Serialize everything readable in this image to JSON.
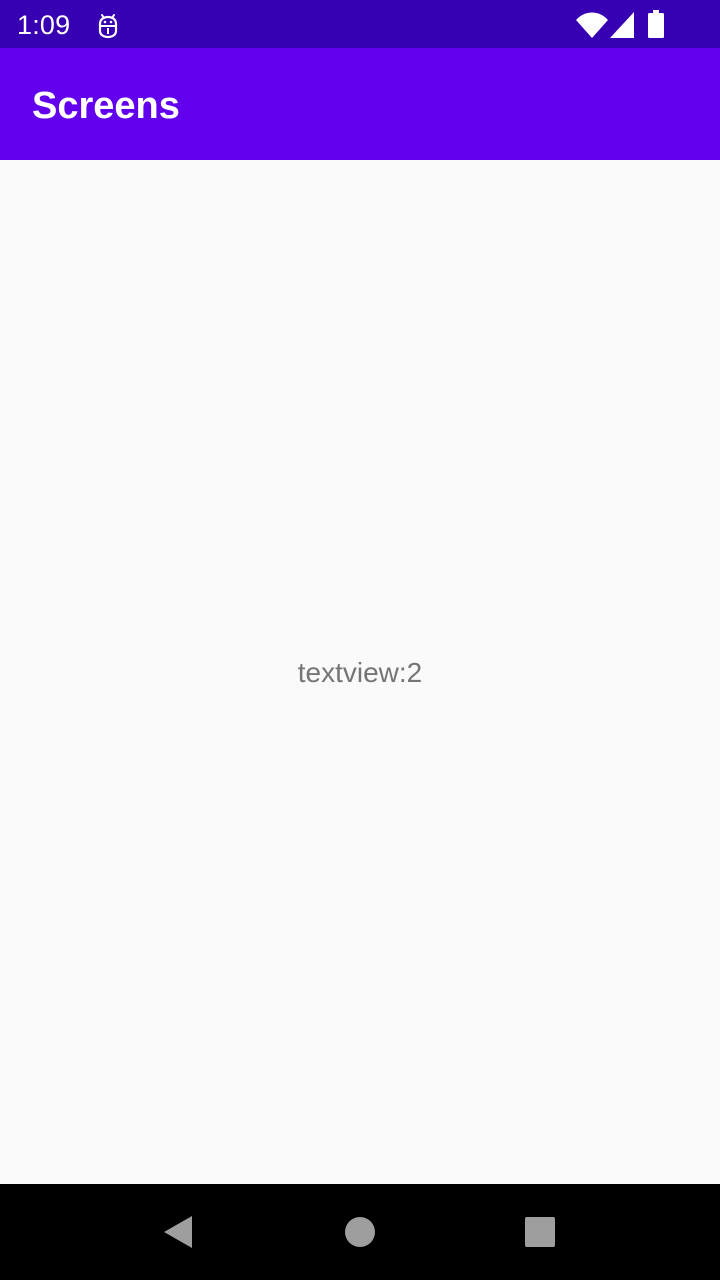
{
  "status_bar": {
    "time": "1:09",
    "app_icon": "android-debug-icon",
    "wifi_icon": "wifi-icon",
    "signal_icon": "cell-signal-icon",
    "battery_icon": "battery-icon",
    "background_color": "#3700b3"
  },
  "app_bar": {
    "title": "Screens",
    "background_color": "#6200ee"
  },
  "main": {
    "text": "textview:2"
  },
  "nav_bar": {
    "back_icon": "back-icon",
    "home_icon": "home-icon",
    "recents_icon": "recents-icon"
  }
}
